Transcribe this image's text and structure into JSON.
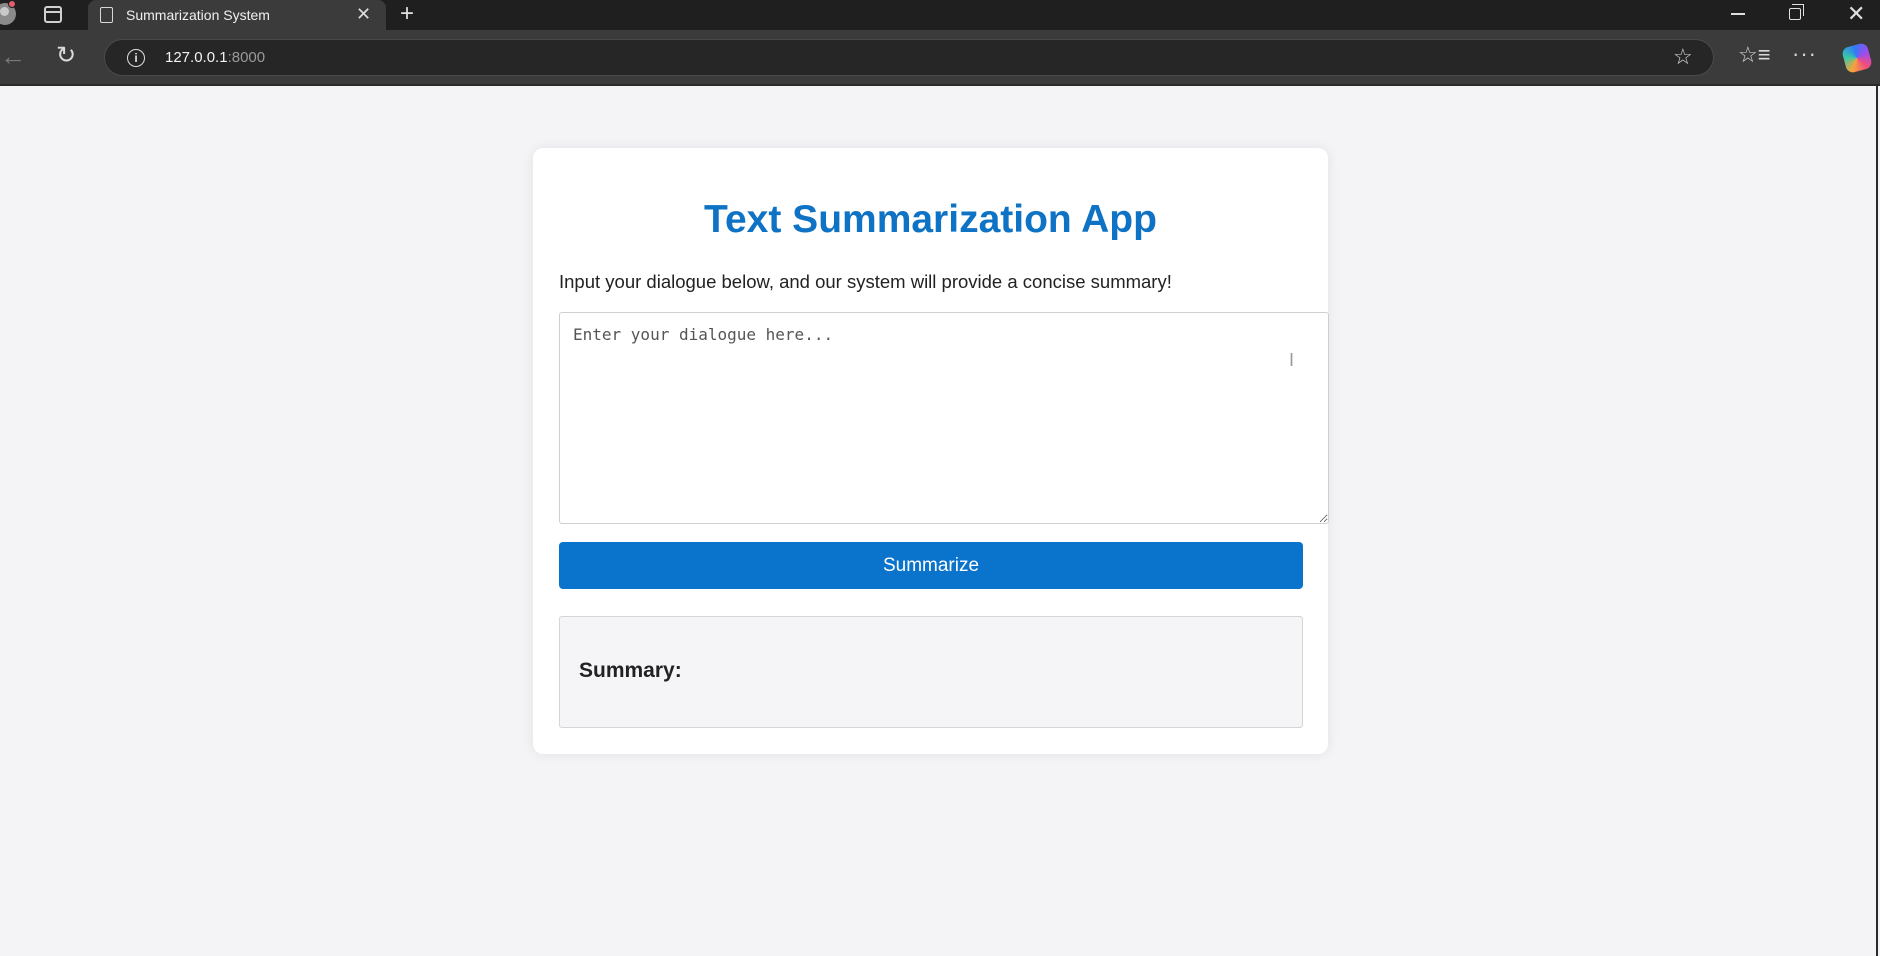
{
  "browser": {
    "tab_title": "Summarization System",
    "url_host": "127.0.0.1",
    "url_port": ":8000",
    "icons": [
      "profile-icon",
      "tab-actions-icon",
      "page-icon",
      "close-icon",
      "new-tab-icon",
      "back-icon",
      "reload-icon",
      "info-icon",
      "star-icon",
      "favorites-icon",
      "more-icon",
      "copilot-icon",
      "minimize-icon",
      "maximize-icon",
      "window-close-icon"
    ]
  },
  "app": {
    "title": "Text Summarization App",
    "intro": "Input your dialogue below, and our system will provide a concise summary!",
    "dialogue_placeholder": "Enter your dialogue here...",
    "dialogue_value": "",
    "button_label": "Summarize",
    "summary_heading": "Summary:",
    "summary_text": ""
  },
  "colors": {
    "accent": "#0a73cb",
    "title": "#0e72c5",
    "page_bg": "#f4f4f7"
  }
}
